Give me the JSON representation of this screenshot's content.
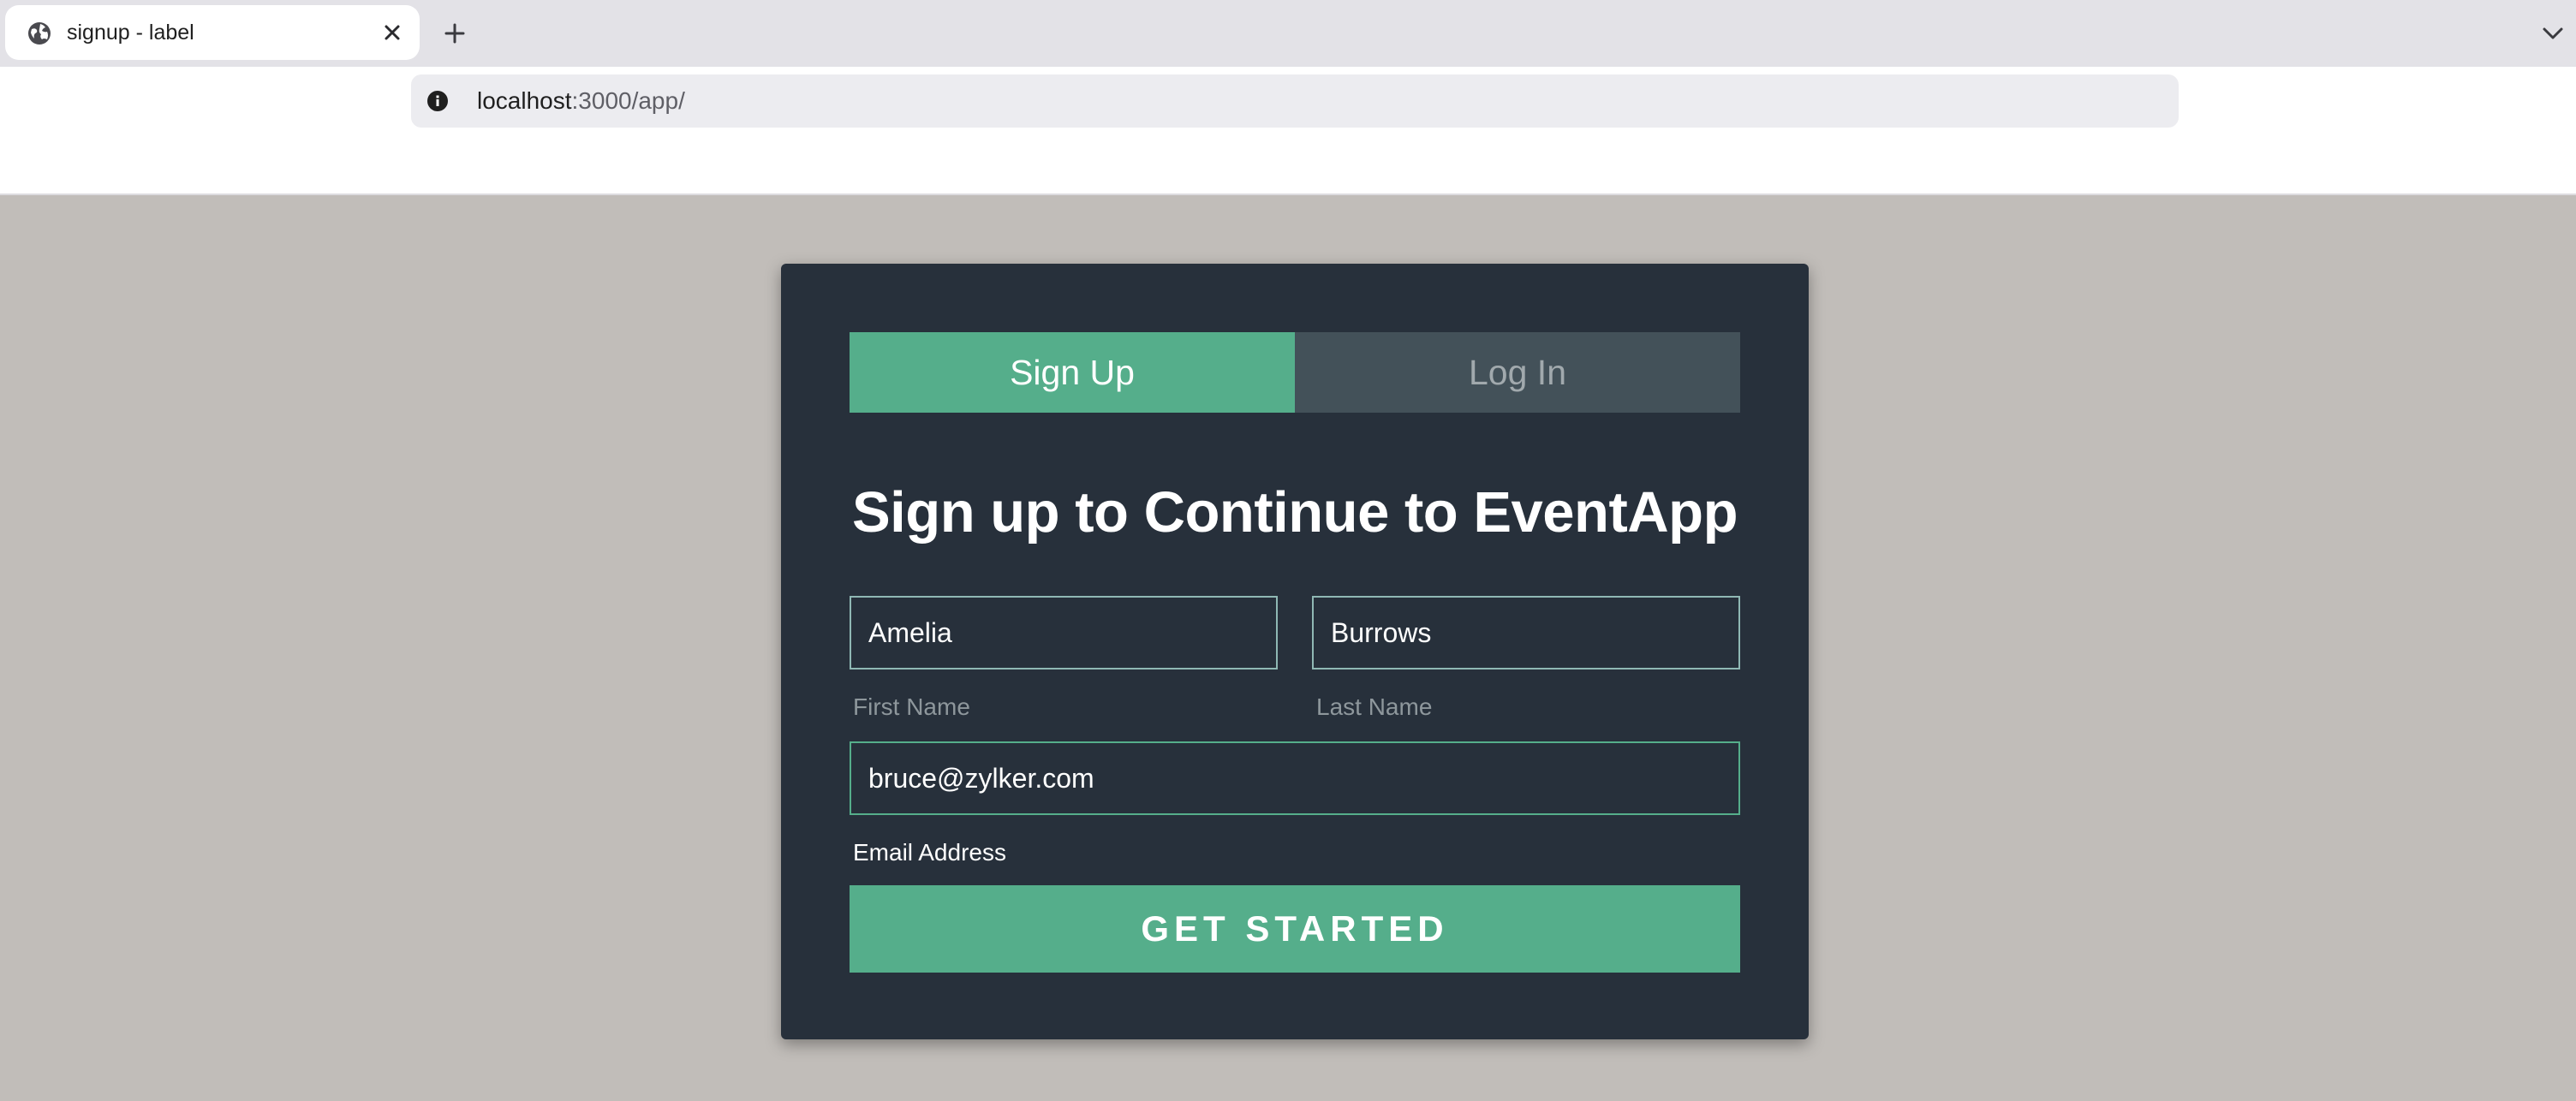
{
  "browser": {
    "tab_title": "signup - label",
    "url_host": "localhost",
    "url_rest": ":3000/app/"
  },
  "icons": {
    "favicon": "globe-icon",
    "close": "close-icon",
    "new_tab": "plus-icon",
    "tab_list": "chevron-down-icon",
    "site_info": "info-icon"
  },
  "auth": {
    "tabs": [
      {
        "label": "Sign Up",
        "active": true
      },
      {
        "label": "Log In",
        "active": false
      }
    ],
    "heading": "Sign up to Continue to EventApp",
    "first_name": {
      "value": "Amelia",
      "caption": "First Name"
    },
    "last_name": {
      "value": "Burrows",
      "caption": "Last Name"
    },
    "email": {
      "value": "bruce@zylker.com",
      "caption": "Email Address"
    },
    "submit_label": "GET STARTED"
  },
  "colors": {
    "accent": "#55ae8b",
    "card_bg": "#27303b",
    "page_bg": "#c1bdb9",
    "inactive_tab": "#435159"
  }
}
